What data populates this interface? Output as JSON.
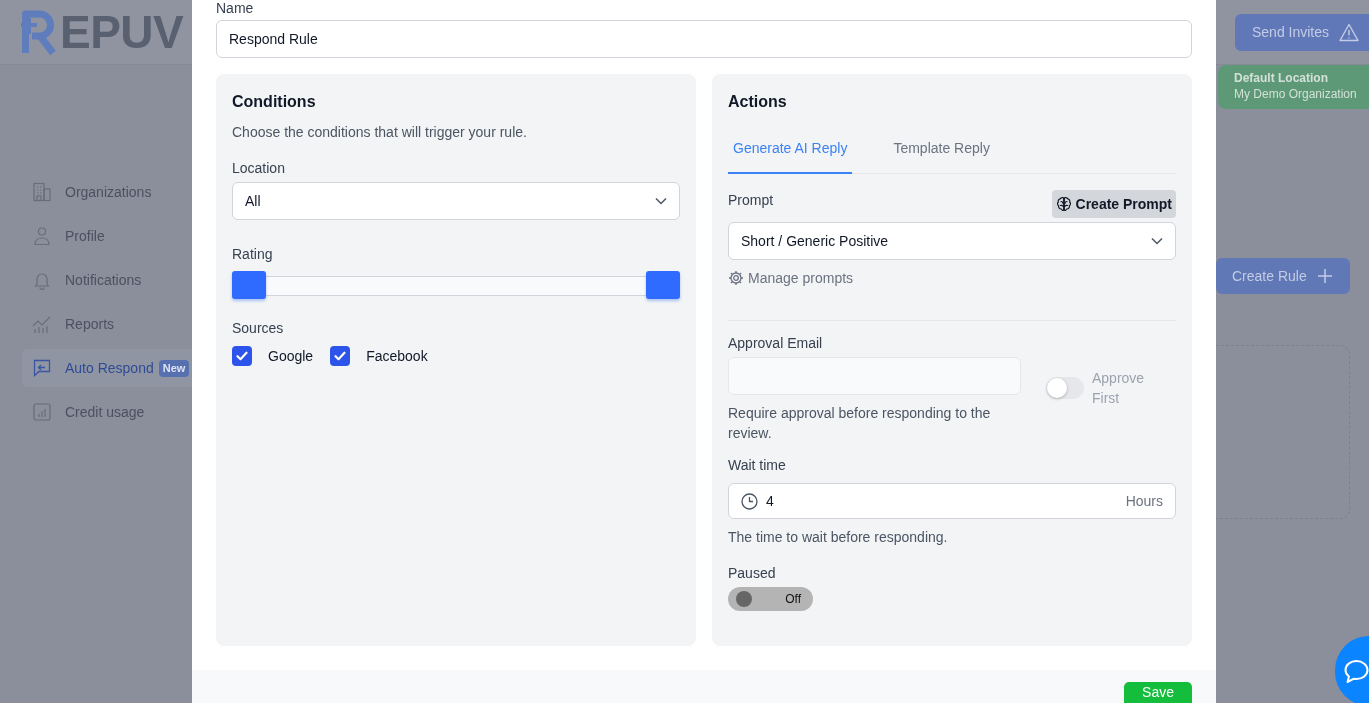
{
  "page": {
    "logo": {
      "text": "EPUV"
    },
    "send_invites_button": {
      "label": "Send Invites"
    },
    "location_card": {
      "title": "Default Location",
      "subtitle": "My Demo Organization"
    },
    "sidebar": {
      "items": [
        {
          "label": "Organizations",
          "selected": false
        },
        {
          "label": "Profile",
          "selected": false
        },
        {
          "label": "Notifications",
          "selected": false
        },
        {
          "label": "Reports",
          "selected": false
        },
        {
          "label": "Auto Respond",
          "selected": true,
          "badge": "New"
        },
        {
          "label": "Credit usage",
          "selected": false
        }
      ]
    },
    "create_rule_button": {
      "label": "Create Rule"
    }
  },
  "modal": {
    "name": {
      "label": "Name",
      "value": "Respond Rule"
    },
    "conditions": {
      "title": "Conditions",
      "description": "Choose the conditions that will trigger your rule.",
      "location": {
        "label": "Location",
        "value": "All"
      },
      "rating": {
        "label": "Rating",
        "thumbs": [
          {
            "level": 0
          },
          {
            "level": 1
          }
        ]
      },
      "sources": {
        "label": "Sources",
        "options": [
          {
            "label": "Google",
            "checked": true
          },
          {
            "label": "Facebook",
            "checked": true
          }
        ]
      }
    },
    "actions": {
      "title": "Actions",
      "tabs": [
        {
          "label": "Generate AI Reply",
          "selected": true
        },
        {
          "label": "Template Reply",
          "selected": false
        }
      ],
      "prompt": {
        "label": "Prompt",
        "value": "Short / Generic Positive"
      },
      "create_prompt_button": {
        "label": "Create Prompt"
      },
      "manage_prompts_link": {
        "label": "Manage prompts"
      },
      "approval_email": {
        "label": "Approval Email",
        "disabled": true,
        "help": "Require approval before responding to the review."
      },
      "approve_first": {
        "label": "Approve First",
        "on": false
      },
      "wait_time": {
        "label": "Wait time",
        "value": "4",
        "unit": "Hours",
        "help": "The time to wait before responding."
      },
      "paused": {
        "label": "Paused",
        "on": false,
        "state_text": "Off"
      }
    },
    "save_button": {
      "label": "Save"
    }
  }
}
